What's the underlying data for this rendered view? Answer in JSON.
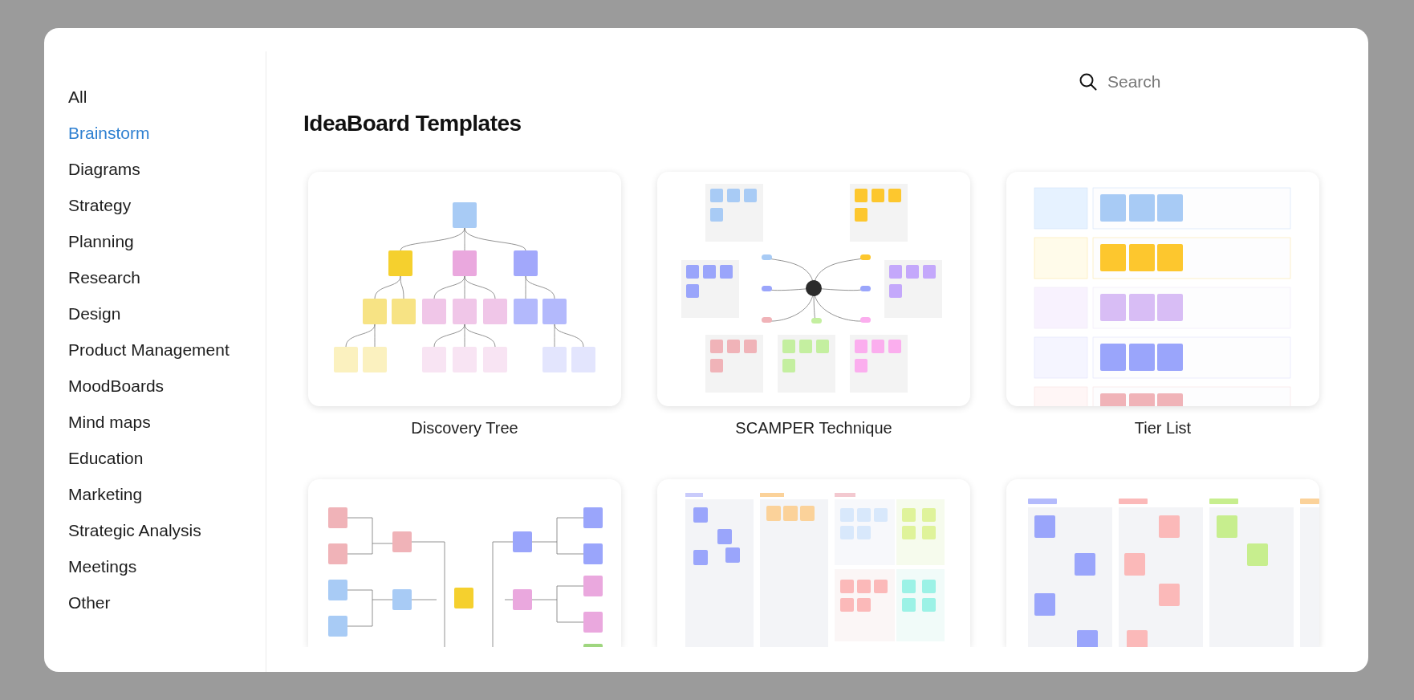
{
  "categories": [
    {
      "label": "All",
      "selected": false
    },
    {
      "label": "Brainstorm",
      "selected": true
    },
    {
      "label": "Diagrams",
      "selected": false
    },
    {
      "label": "Strategy",
      "selected": false
    },
    {
      "label": "Planning",
      "selected": false
    },
    {
      "label": "Research",
      "selected": false
    },
    {
      "label": "Design",
      "selected": false
    },
    {
      "label": "Product Management",
      "selected": false
    },
    {
      "label": "MoodBoards",
      "selected": false
    },
    {
      "label": "Mind maps",
      "selected": false
    },
    {
      "label": "Education",
      "selected": false
    },
    {
      "label": "Marketing",
      "selected": false
    },
    {
      "label": "Strategic Analysis",
      "selected": false
    },
    {
      "label": "Meetings",
      "selected": false
    },
    {
      "label": "Other",
      "selected": false
    }
  ],
  "search": {
    "placeholder": "Search"
  },
  "title": "IdeaBoard Templates",
  "templates": [
    {
      "name": "Discovery Tree",
      "kind": "tree"
    },
    {
      "name": "SCAMPER Technique",
      "kind": "mindmap"
    },
    {
      "name": "Tier List",
      "kind": "tier"
    },
    {
      "kind": "bracket"
    },
    {
      "kind": "columns"
    },
    {
      "kind": "sort"
    }
  ]
}
